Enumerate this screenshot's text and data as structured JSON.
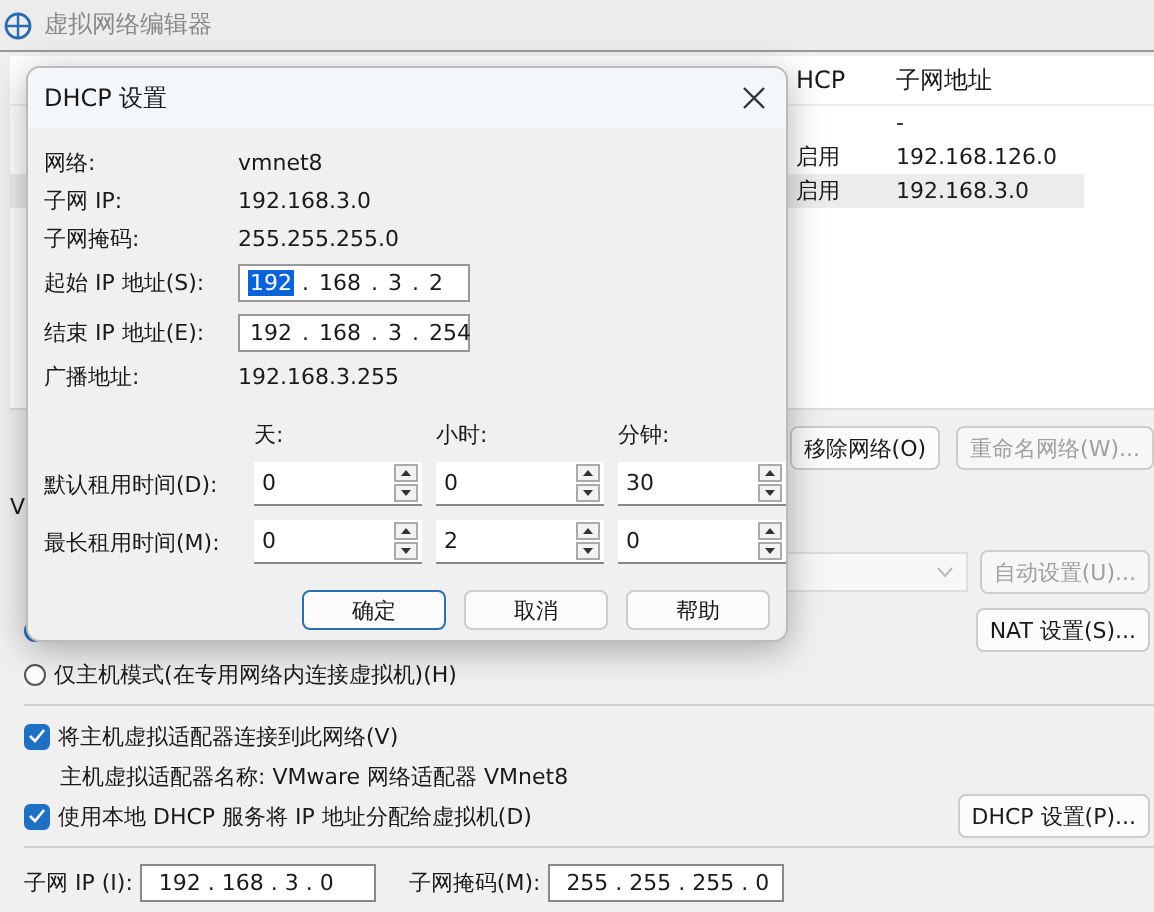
{
  "window": {
    "title": "虚拟网络编辑器"
  },
  "table": {
    "columns": [
      {
        "label": "HCP"
      },
      {
        "label": "子网地址"
      }
    ],
    "rows": [
      {
        "subnet": "-",
        "selected": false
      },
      {
        "dhcp": "启用",
        "subnet": "192.168.126.0",
        "selected": false
      },
      {
        "dhcp": "启用",
        "subnet": "192.168.3.0",
        "selected": true
      }
    ]
  },
  "network_buttons": [
    {
      "label": "移除网络(O)",
      "disabled": false
    },
    {
      "label": "重命名网络(W)...",
      "disabled": true
    }
  ],
  "info_label": "V",
  "auto_button": {
    "label": "自动设置(U)...",
    "disabled": true
  },
  "nat_button": {
    "label": "NAT 设置(S)...",
    "disabled": false
  },
  "radios": [
    {
      "selected": true
    },
    {
      "label": "仅主机模式(在专用网络内连接虚拟机)(H)",
      "selected": false
    }
  ],
  "host_adapter": {
    "label": "将主机虚拟适配器连接到此网络(V)",
    "checked": true,
    "name_text": "主机虚拟适配器名称: VMware 网络适配器 VMnet8"
  },
  "dhcp_service": {
    "label": "使用本地 DHCP 服务将 IP 地址分配给虚拟机(D)",
    "checked": true,
    "button": "DHCP 设置(P)..."
  },
  "subnet": {
    "ip_label": "子网 IP (I):",
    "ip": "192 . 168 . 3 . 0",
    "mask_label": "子网掩码(M):",
    "mask": "255 . 255 . 255 . 0"
  },
  "dialog": {
    "title": "DHCP 设置",
    "info": [
      {
        "label": "网络:",
        "value": "vmnet8"
      },
      {
        "label": "子网 IP:",
        "value": "192.168.3.0"
      },
      {
        "label": "子网掩码:",
        "value": "255.255.255.0"
      }
    ],
    "ip_fields": [
      {
        "label": "起始 IP 地址(S):",
        "octets": [
          {
            "text": "192",
            "highlighted": true
          },
          {
            "text": ".",
            "highlighted": false
          },
          {
            "text": "168",
            "highlighted": false
          },
          {
            "text": ".",
            "highlighted": false
          },
          {
            "text": "3",
            "highlighted": false
          },
          {
            "text": ".",
            "highlighted": false
          },
          {
            "text": "2",
            "highlighted": false
          }
        ]
      },
      {
        "label": "结束 IP 地址(E):",
        "octets": [
          {
            "text": "192",
            "highlighted": false
          },
          {
            "text": ".",
            "highlighted": false
          },
          {
            "text": "168",
            "highlighted": false
          },
          {
            "text": ".",
            "highlighted": false
          },
          {
            "text": "3",
            "highlighted": false
          },
          {
            "text": ".",
            "highlighted": false
          },
          {
            "text": "254",
            "highlighted": false
          }
        ]
      }
    ],
    "broadcast": {
      "label": "广播地址:",
      "value": "192.168.3.255"
    },
    "lease_columns": [
      "天:",
      "小时:",
      "分钟:"
    ],
    "leases": [
      {
        "label": "默认租用时间(D):",
        "values": [
          "0",
          "0",
          "30"
        ]
      },
      {
        "label": "最长租用时间(M):",
        "values": [
          "0",
          "2",
          "0"
        ]
      }
    ],
    "buttons": [
      {
        "label": "确定",
        "default": true
      },
      {
        "label": "取消",
        "default": false
      },
      {
        "label": "帮助",
        "default": false
      }
    ]
  }
}
